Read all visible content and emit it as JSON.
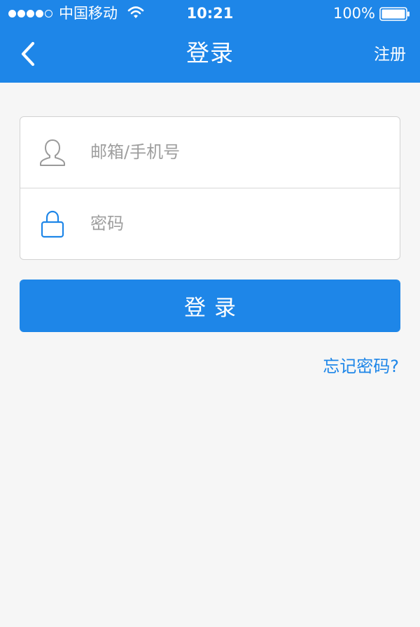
{
  "colors": {
    "primary": "#1e86e8",
    "background": "#f6f6f6",
    "card": "#ffffff",
    "placeholder": "#9e9e9e",
    "border": "#d2d2d2"
  },
  "status_bar": {
    "signal_strength": "4 of 5",
    "carrier": "中国移动",
    "time": "10:21",
    "battery_percent": "100%",
    "icons": [
      "signal-dots-icon",
      "wifi-icon",
      "battery-icon"
    ]
  },
  "nav": {
    "back_icon": "chevron-left-icon",
    "title": "登录",
    "register_label": "注册"
  },
  "form": {
    "account": {
      "icon": "user-icon",
      "placeholder": "邮箱/手机号",
      "value": ""
    },
    "password": {
      "icon": "lock-icon",
      "placeholder": "密码",
      "value": ""
    }
  },
  "login_button": {
    "label": "登录"
  },
  "forgot_password": {
    "label": "忘记密码?"
  }
}
